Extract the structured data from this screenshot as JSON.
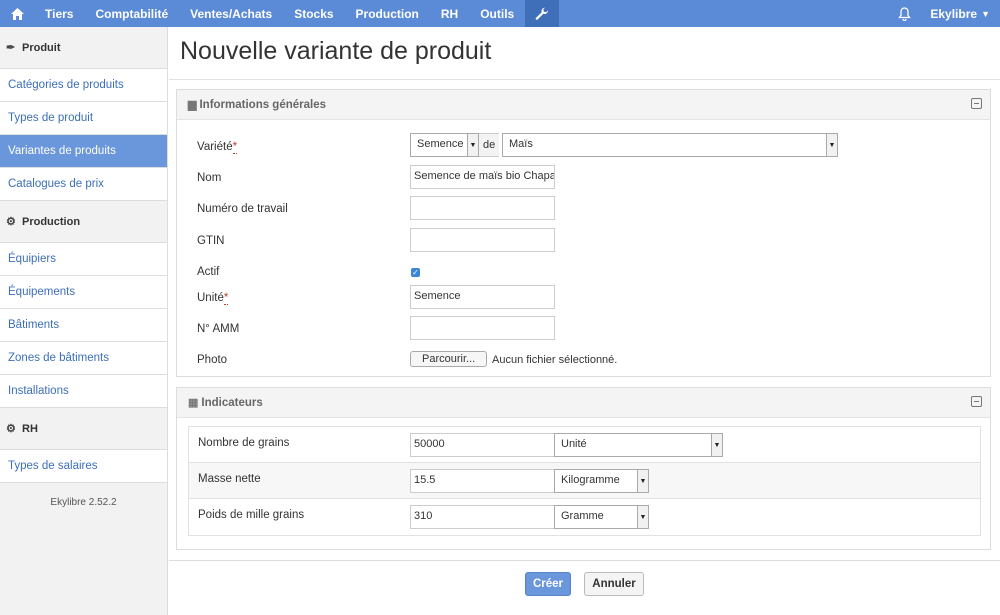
{
  "nav": {
    "items": [
      "Tiers",
      "Comptabilité",
      "Ventes/Achats",
      "Stocks",
      "Production",
      "RH",
      "Outils"
    ],
    "user": "Ekylibre"
  },
  "sidebar": {
    "sections": [
      {
        "title": "Produit",
        "icon": "feather-icon",
        "items": [
          "Catégories de produits",
          "Types de produit",
          "Variantes de produits",
          "Catalogues de prix"
        ]
      },
      {
        "title": "Production",
        "icon": "cogs-icon",
        "items": [
          "Équipiers",
          "Équipements",
          "Bâtiments",
          "Zones de bâtiments",
          "Installations"
        ]
      },
      {
        "title": "RH",
        "icon": "gear-icon",
        "items": [
          "Types de salaires"
        ]
      }
    ],
    "active_item": "Variantes de produits",
    "version": "Ekylibre 2.52.2"
  },
  "page": {
    "title": "Nouvelle variante de produit"
  },
  "general": {
    "title": "Informations générales",
    "variety_label": "Variété",
    "variety_value": "Semence",
    "variety_de": "de",
    "variety_parent": "Maïs",
    "name_label": "Nom",
    "name_value": "Semence de maïs bio Chapa",
    "work_number_label": "Numéro de travail",
    "work_number_value": "",
    "gtin_label": "GTIN",
    "gtin_value": "",
    "active_label": "Actif",
    "active_checked": true,
    "unit_label": "Unité",
    "unit_value": "Semence",
    "amm_label": "N° AMM",
    "amm_value": "",
    "photo_label": "Photo",
    "photo_button": "Parcourir...",
    "photo_status": "Aucun fichier sélectionné."
  },
  "indicators": {
    "title": "Indicateurs",
    "rows": [
      {
        "label": "Nombre de grains",
        "value": "50000",
        "unit": "Unité"
      },
      {
        "label": "Masse nette",
        "value": "15.5",
        "unit": "Kilogramme"
      },
      {
        "label": "Poids de mille grains",
        "value": "310",
        "unit": "Gramme"
      }
    ]
  },
  "actions": {
    "create": "Créer",
    "cancel": "Annuler"
  },
  "colors": {
    "nav": "#5b8ad6",
    "active": "#6a96dc",
    "link": "#3c6fb8",
    "required": "#c0392b"
  }
}
